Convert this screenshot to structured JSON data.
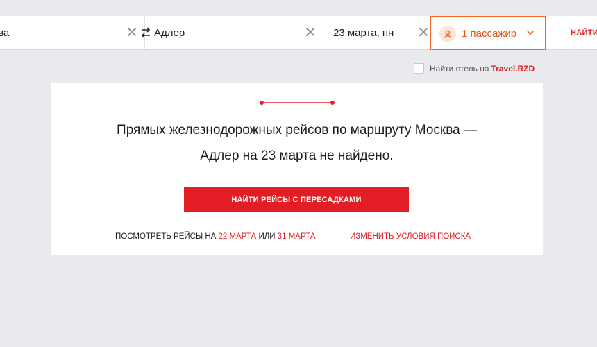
{
  "search": {
    "from_value": "Москва",
    "to_value": "Адлер",
    "date_value": "23 марта, пн",
    "passengers_label": "1 пассажир",
    "find_label": "НАЙТИ"
  },
  "hotel": {
    "label": "Найти отель на",
    "brand": "Travel.RZD"
  },
  "result": {
    "message_line1": "Прямых железнодорожных рейсов по маршруту Москва —",
    "message_line2": "Адлер на 23 марта не найдено.",
    "cta_label": "НАЙТИ РЕЙСЫ С ПЕРЕСАДКАМИ",
    "alt_prefix": "ПОСМОТРЕТЬ РЕЙСЫ НА",
    "alt_date1": "22 МАРТА",
    "alt_or": "ИЛИ",
    "alt_date2": "31 МАРТА",
    "change_label": "ИЗМЕНИТЬ УСЛОВИЯ ПОИСКА"
  },
  "colors": {
    "accent_red": "#e32127",
    "accent_orange": "#f0691e",
    "background": "#e9eaee"
  },
  "icons": [
    "clear-icon",
    "swap-icon",
    "passenger-icon",
    "chevron-down-icon",
    "checkbox"
  ]
}
